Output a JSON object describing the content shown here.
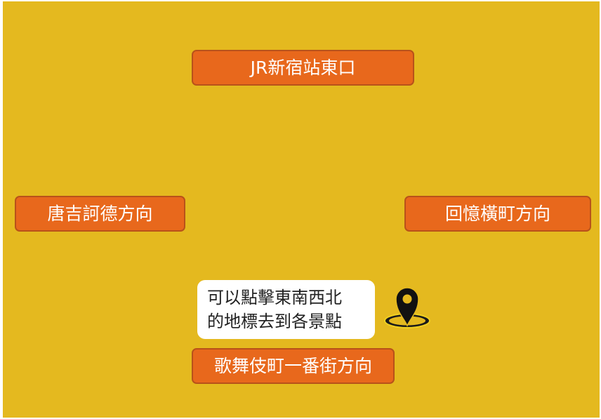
{
  "buttons": {
    "north": "JR新宿站東口",
    "west": "唐吉訶德方向",
    "east": "回憶橫町方向",
    "south": "歌舞伎町一番街方向"
  },
  "hint": {
    "line1": "可以點擊東南西北",
    "line2": "的地標去到各景點"
  },
  "icons": {
    "pin": "map-pin-icon"
  },
  "colors": {
    "background": "#e4b91f",
    "button": "#e8681c",
    "button_text": "#ffffff"
  }
}
